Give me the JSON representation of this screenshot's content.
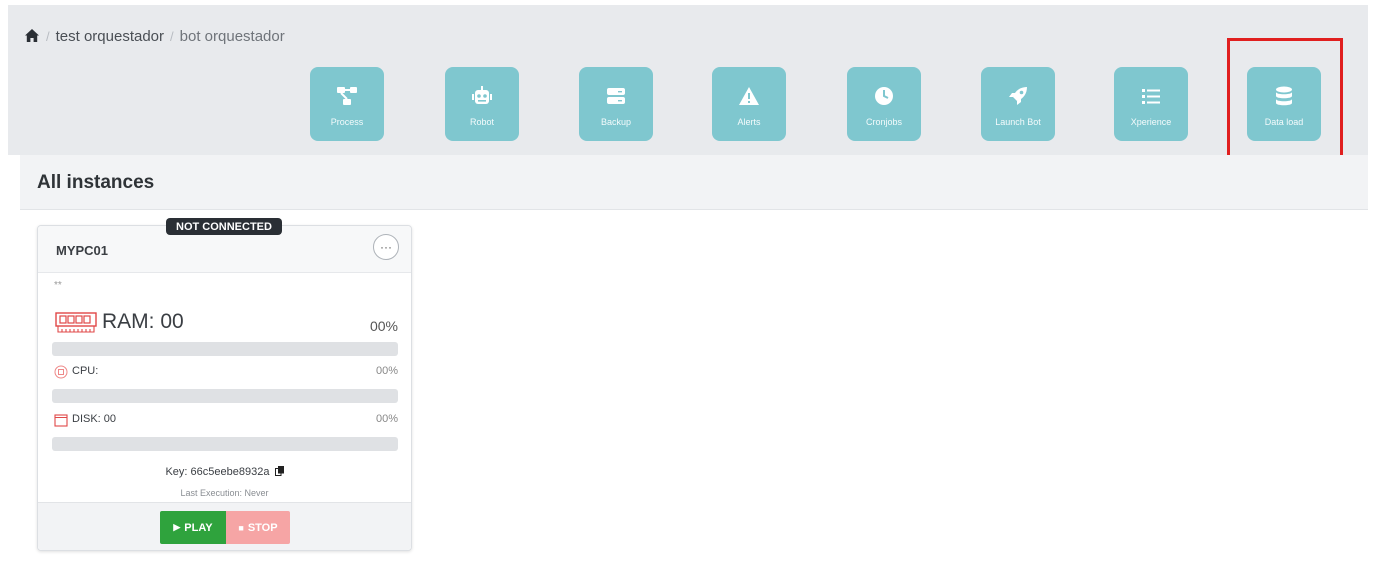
{
  "breadcrumb": {
    "home_icon": "home-icon",
    "items": [
      "test orquestador",
      "bot orquestador"
    ]
  },
  "toolbar": {
    "buttons": [
      {
        "label": "Process",
        "icon": "process-icon"
      },
      {
        "label": "Robot",
        "icon": "robot-icon"
      },
      {
        "label": "Backup",
        "icon": "server-icon"
      },
      {
        "label": "Alerts",
        "icon": "alert-icon"
      },
      {
        "label": "Cronjobs",
        "icon": "clock-icon"
      },
      {
        "label": "Launch Bot",
        "icon": "rocket-icon"
      },
      {
        "label": "Xperience",
        "icon": "list-icon"
      },
      {
        "label": "Data load",
        "icon": "database-icon"
      }
    ],
    "color": "#7fc7cf"
  },
  "highlight_color": "#e01f1f",
  "section": {
    "title": "All instances"
  },
  "instance": {
    "status": "NOT CONNECTED",
    "name": "MYPC01",
    "more_label": "···",
    "description": "**",
    "ram": {
      "label": "RAM: 00",
      "percent": "00%",
      "fill_fraction": 0
    },
    "cpu": {
      "label": "CPU:",
      "percent": "00%",
      "fill_fraction": 0
    },
    "disk": {
      "label": "DISK: 00",
      "percent": "00%",
      "fill_fraction": 0
    },
    "key": "Key: 66c5eebe8932a",
    "last_execution": "Last Execution: Never",
    "play_label": "PLAY",
    "stop_label": "STOP",
    "play_color": "#2fa33d",
    "stop_color": "#f6a5a5"
  }
}
